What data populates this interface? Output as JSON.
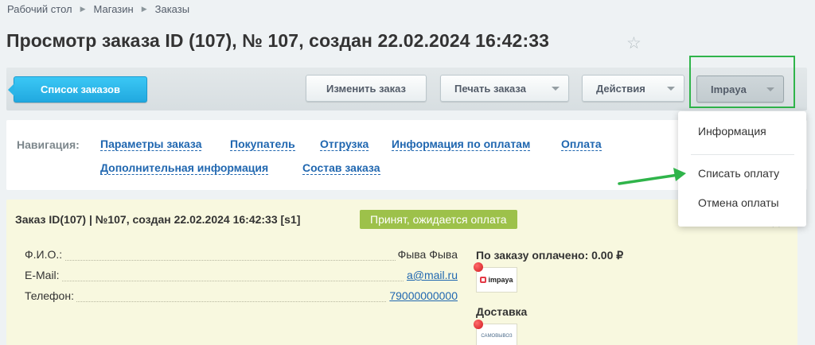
{
  "breadcrumb": [
    "Рабочий стол",
    "Магазин",
    "Заказы"
  ],
  "page_title": "Просмотр заказа ID (107), № 107, создан 22.02.2024 16:42:33",
  "toolbar": {
    "list_button": "Список заказов",
    "edit_button": "Изменить заказ",
    "print_button": "Печать заказа",
    "actions_button": "Действия",
    "impaya_button": "Impaya"
  },
  "navigation": {
    "label": "Навигация:",
    "links": [
      "Параметры заказа",
      "Покупатель",
      "Отгрузка",
      "Информация по оплатам",
      "Оплата",
      "Дополнительная информация",
      "Состав заказа"
    ]
  },
  "order": {
    "title": "Заказ ID(107) | №107, создан 22.02.2024 16:42:33 [s1]",
    "status": "Принят, ожидается оплата",
    "fields": [
      {
        "label": "Ф.И.О.:",
        "value": "Фыва Фыва"
      },
      {
        "label": "E-Mail:",
        "value": "a@mail.ru"
      },
      {
        "label": "Телефон:",
        "value": "79000000000"
      }
    ],
    "paid_title": "По заказу оплачено: 0.00 ₽",
    "payment_logo_text": "impaya",
    "delivery_title": "Доставка",
    "delivery_logo_text": "САМОВЫВОЗ"
  },
  "dropdown": {
    "items": [
      "Информация",
      "Списать оплату",
      "Отмена оплаты"
    ]
  },
  "colors": {
    "accent_blue": "#21a9df",
    "link_blue": "#2067b0",
    "status_green": "#9dc14a",
    "highlight_green": "#2fb44a"
  }
}
